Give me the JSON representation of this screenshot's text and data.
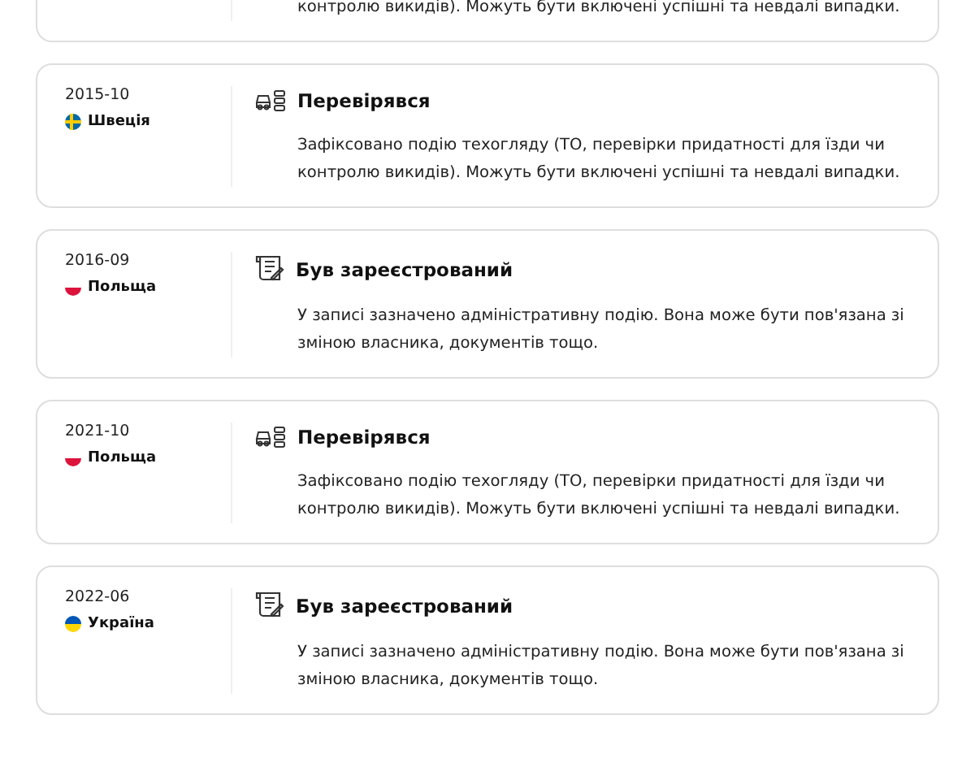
{
  "events": [
    {
      "description": "контролю викидів). Можуть бути включені успішні та невдалі випадки."
    },
    {
      "kind": "inspected",
      "date": "2015-10",
      "country": {
        "kind": "sweden",
        "name": "Швеція"
      },
      "title": "Перевірявся",
      "description": "Зафіксовано подію техогляду (ТО, перевірки придатності для їзди чи контролю викидів). Можуть бути включені успішні та невдалі випадки."
    },
    {
      "kind": "registered",
      "date": "2016-09",
      "country": {
        "kind": "poland",
        "name": "Польща"
      },
      "title": "Був зареєстрований",
      "description": "У записі зазначено адміністративну подію. Вона може бути пов'язана зі зміною власника, документів тощо."
    },
    {
      "kind": "inspected",
      "date": "2021-10",
      "country": {
        "kind": "poland",
        "name": "Польща"
      },
      "title": "Перевірявся",
      "description": "Зафіксовано подію техогляду (ТО, перевірки придатності для їзди чи контролю викидів). Можуть бути включені успішні та невдалі випадки."
    },
    {
      "kind": "registered",
      "date": "2022-06",
      "country": {
        "kind": "ukraine",
        "name": "Україна"
      },
      "title": "Був зареєстрований",
      "description": "У записі зазначено адміністративну подію. Вона може бути пов'язана зі зміною власника, документів тощо."
    }
  ]
}
